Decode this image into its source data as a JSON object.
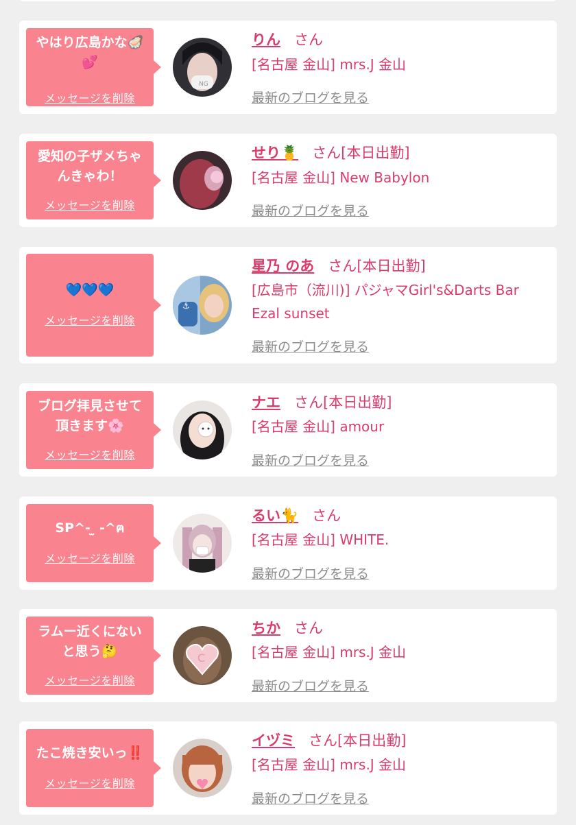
{
  "delete_label": "メッセージを削除",
  "san_label": "さん",
  "blog_label": "最新のブログを見る",
  "colors": {
    "accent": "#d93b6b",
    "bubble": "#f9838f",
    "background": "#efeff0"
  },
  "entries": [
    {
      "message": "やはり広島かな🦪\n💕",
      "name": "りん",
      "status": "",
      "shop": "[名古屋 金山] mrs.J 金山",
      "avatar_icon": "girl-masked-icon"
    },
    {
      "message": "愛知の子ザメちゃ\nんきゃわ！",
      "name": "せり🍍",
      "status": "[本日出勤]",
      "shop": "[名古屋 金山] New Babylon",
      "avatar_icon": "girl-redhair-icon"
    },
    {
      "message": "💙💙💙",
      "name": "星乃 のあ",
      "status": "[本日出勤]",
      "shop": "[広島市（流川)] パジャマGirl's&Darts Bar Ezal sunset",
      "avatar_icon": "girl-blonde-icon"
    },
    {
      "message": "ブログ拝見させて\n頂きます🌸",
      "name": "ナエ",
      "status": "[本日出勤]",
      "shop": "[名古屋 金山] amour",
      "avatar_icon": "girl-cat-sticker-icon"
    },
    {
      "message": "SP^- ̫ -^ฅ",
      "name": "るい🐈",
      "status": "",
      "shop": "[名古屋 金山] WHITE.",
      "avatar_icon": "girl-twintail-icon"
    },
    {
      "message": "ラムー近くにない\nと思う🤔",
      "name": "ちか",
      "status": "",
      "shop": "[名古屋 金山] mrs.J 金山",
      "avatar_icon": "girl-heart-sticker-icon"
    },
    {
      "message": "たこ焼き安いっ‼️",
      "name": "イヅミ",
      "status": "[本日出勤]",
      "shop": "[名古屋 金山] mrs.J 金山",
      "avatar_icon": "girl-bob-icon"
    }
  ]
}
